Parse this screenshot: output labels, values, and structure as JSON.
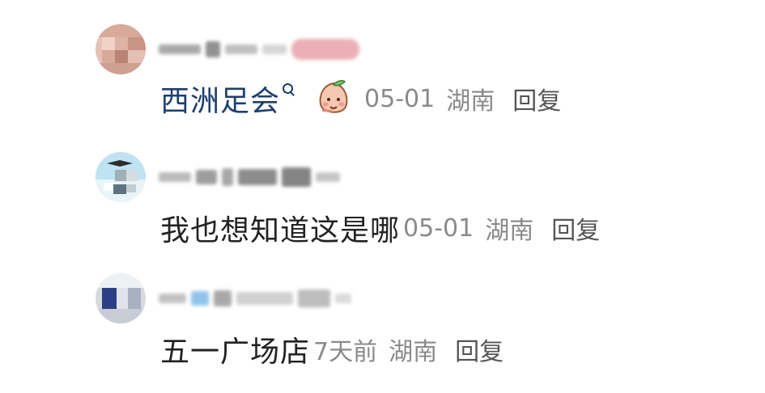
{
  "comments": [
    {
      "avatar": "user-avatar-face",
      "hashtag": "西洲足会",
      "hashtag_icon": "search-icon",
      "emoji": "peach-emoji",
      "time": "05-01",
      "location": "湖南",
      "reply_label": "回复"
    },
    {
      "avatar": "user-avatar-sky",
      "text": "我也想知道这是哪",
      "time": "05-01",
      "location": "湖南",
      "reply_label": "回复"
    },
    {
      "avatar": "user-avatar-blue",
      "text": "五一广场店",
      "time": "7天前",
      "location": "湖南",
      "reply_label": "回复"
    }
  ],
  "colors": {
    "text": "#222222",
    "link": "#1d3f6e",
    "meta": "#8a8a8a",
    "reply": "#555555"
  }
}
